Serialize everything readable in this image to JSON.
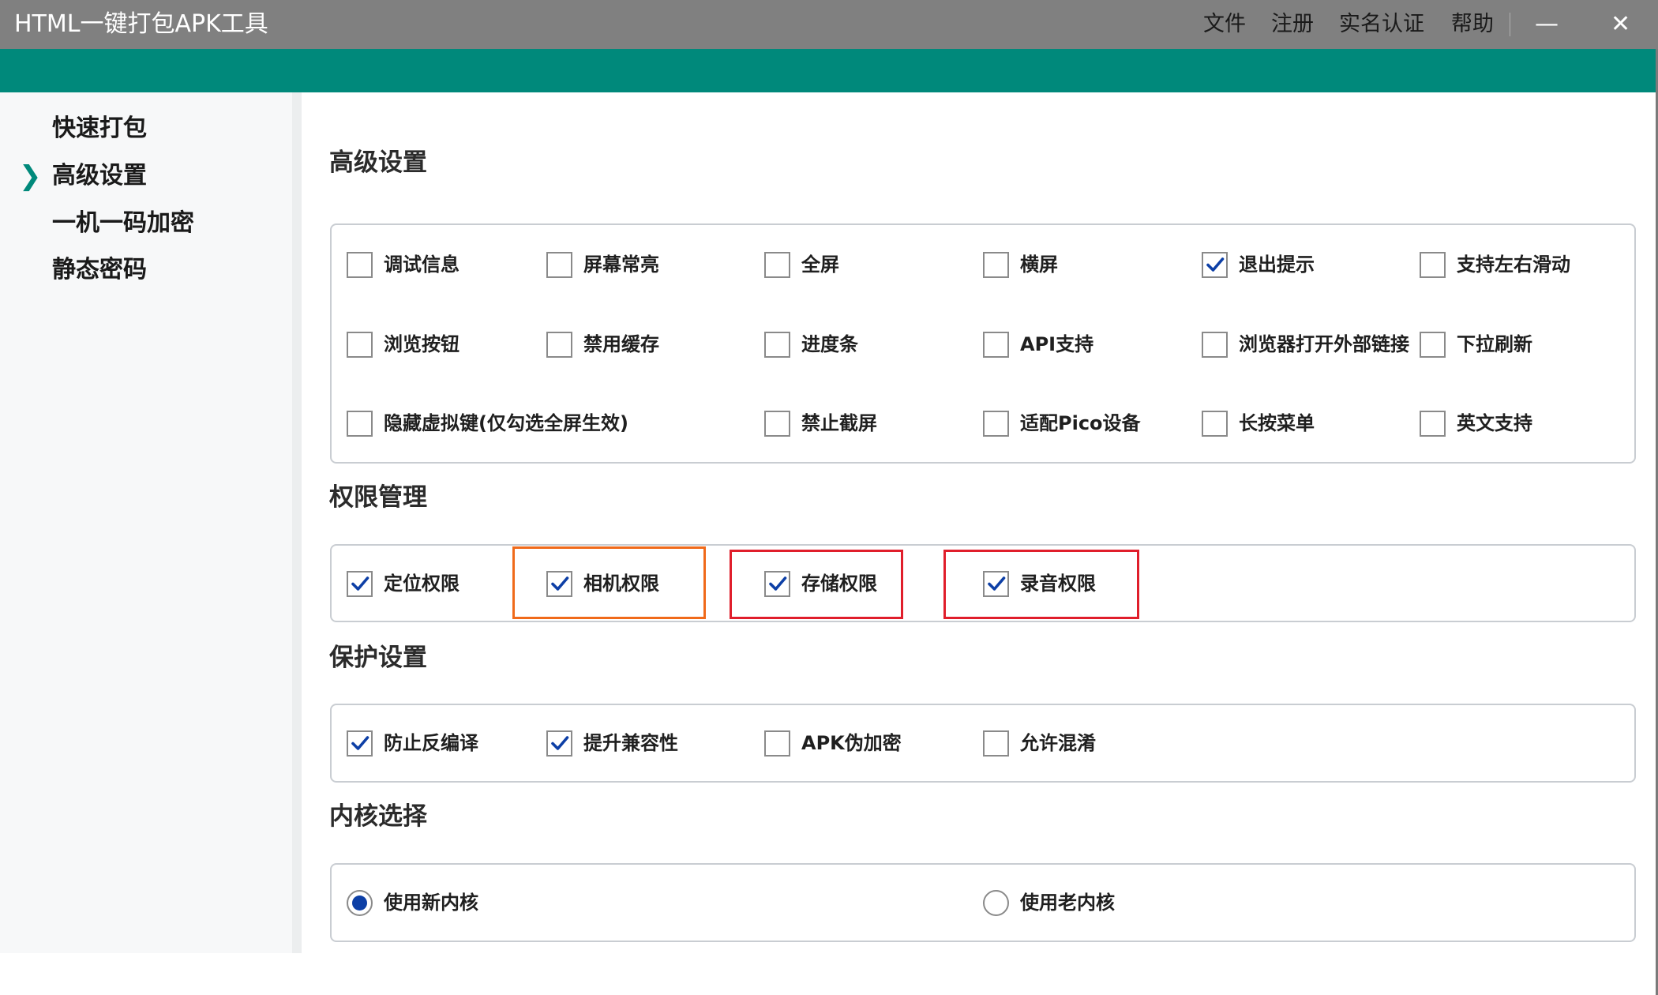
{
  "window": {
    "title": "HTML一键打包APK工具",
    "menu": [
      "文件",
      "注册",
      "实名认证",
      "帮助"
    ],
    "minimize_icon": "minimize-icon",
    "close_icon": "close-icon"
  },
  "colors": {
    "accent": "#00897b",
    "titlebar": "#808080",
    "check": "#0d3fa6",
    "highlight_orange": "#f06a1a",
    "highlight_red": "#e01e2b"
  },
  "sidebar": {
    "items": [
      {
        "label": "快速打包",
        "active": false
      },
      {
        "label": "高级设置",
        "active": true
      },
      {
        "label": "一机一码加密",
        "active": false
      },
      {
        "label": "静态密码",
        "active": false
      }
    ]
  },
  "sections": {
    "advanced": {
      "title": "高级设置",
      "options": [
        {
          "label": "调试信息",
          "checked": false
        },
        {
          "label": "屏幕常亮",
          "checked": false
        },
        {
          "label": "全屏",
          "checked": false
        },
        {
          "label": "横屏",
          "checked": false
        },
        {
          "label": "退出提示",
          "checked": true
        },
        {
          "label": "支持左右滑动",
          "checked": false
        },
        {
          "label": "浏览按钮",
          "checked": false
        },
        {
          "label": "禁用缓存",
          "checked": false
        },
        {
          "label": "进度条",
          "checked": false
        },
        {
          "label": "API支持",
          "checked": false
        },
        {
          "label": "浏览器打开外部链接",
          "checked": false
        },
        {
          "label": "下拉刷新",
          "checked": false
        },
        {
          "label": "隐藏虚拟键(仅勾选全屏生效)",
          "checked": false
        },
        {
          "label": "禁止截屏",
          "checked": false
        },
        {
          "label": "适配Pico设备",
          "checked": false
        },
        {
          "label": "长按菜单",
          "checked": false
        },
        {
          "label": "英文支持",
          "checked": false
        }
      ]
    },
    "permissions": {
      "title": "权限管理",
      "options": [
        {
          "label": "定位权限",
          "checked": true
        },
        {
          "label": "相机权限",
          "checked": true
        },
        {
          "label": "存储权限",
          "checked": true
        },
        {
          "label": "录音权限",
          "checked": true
        }
      ]
    },
    "protection": {
      "title": "保护设置",
      "options": [
        {
          "label": "防止反编译",
          "checked": true
        },
        {
          "label": "提升兼容性",
          "checked": true
        },
        {
          "label": "APK伪加密",
          "checked": false
        },
        {
          "label": "允许混淆",
          "checked": false
        }
      ]
    },
    "kernel": {
      "title": "内核选择",
      "options": [
        {
          "label": "使用新内核",
          "selected": true
        },
        {
          "label": "使用老内核",
          "selected": false
        }
      ]
    }
  }
}
